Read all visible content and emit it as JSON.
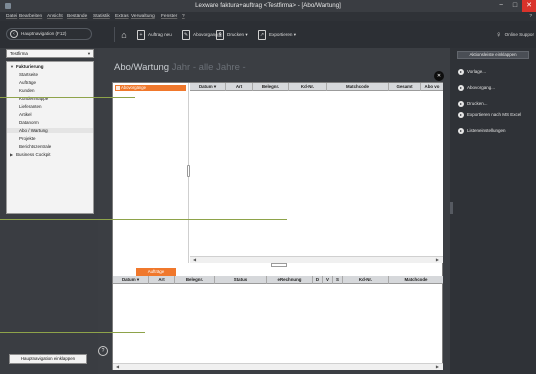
{
  "window": {
    "title": "Lexware faktura+auftrag <Testfirma> - [Abo/Wartung]",
    "buttons": {
      "min": "−",
      "max": "□",
      "close": "✕"
    }
  },
  "menu": {
    "items": [
      "Datei",
      "Bearbeiten",
      "Ansicht",
      "Bestände",
      "Statistik",
      "Extras",
      "Verwaltung",
      "Fenster",
      "?"
    ],
    "help": "?"
  },
  "toolbar": {
    "nav_toggle_label": "Hauptnavigation (F12)",
    "new_order_label": "Auftrag neu",
    "subscription_label": "Abovorgang",
    "print_label": "Drucken",
    "export_label": "Exportieren",
    "online_support_label": "Online Suppor",
    "dropdown_mark": "▾"
  },
  "sidebar": {
    "company": "Testfirma",
    "tree": {
      "group_label": "Fakturierung",
      "items": [
        "Startseite",
        "Aufträge",
        "Kunden",
        "Kundenmappe",
        "Lieferanten",
        "Artikel",
        "Datanorm",
        "Abo / Wartung",
        "Projekte",
        "Berichtszentrale"
      ],
      "selected_index": 7,
      "second_group_label": "Business Cockpit"
    },
    "collapse_button": "Hauptnavigation einklappen"
  },
  "main": {
    "title": "Abo/Wartung",
    "subtitle": "Jahr - alle Jahre -",
    "tree_selected_item": "Abovorgänge",
    "top_columns": [
      "Datum",
      "Art",
      "Belegnr.",
      "Kd-Nr.",
      "Matchcode",
      "Gesamt",
      "Abo vo"
    ],
    "tab_label": "Aufträge",
    "bottom_columns": [
      "Datum",
      "Art",
      "Belegnr.",
      "Status",
      "eRechnung",
      "D",
      "V",
      "S",
      "Kd-Nr.",
      "Matchcode"
    ],
    "info_glyph": "?"
  },
  "rightpanel": {
    "collapse_actions_label": "Aktionsleiste einklappen",
    "actions": [
      {
        "label": "Vorlage...",
        "icon": "template-icon"
      },
      {
        "label": "Abovorgang...",
        "icon": "subscription-icon"
      },
      {
        "label": "Drucken...",
        "icon": "print-icon"
      },
      {
        "label": "Exportieren nach MS Excel",
        "icon": "excel-export-icon"
      },
      {
        "label": "Listeneinstellungen",
        "icon": "list-settings-icon"
      }
    ]
  },
  "colors": {
    "accent_orange": "#f0782c",
    "callout_green": "#8ea34a",
    "chrome_dark": "#2f3237",
    "panel_gray": "#3b3e43"
  }
}
